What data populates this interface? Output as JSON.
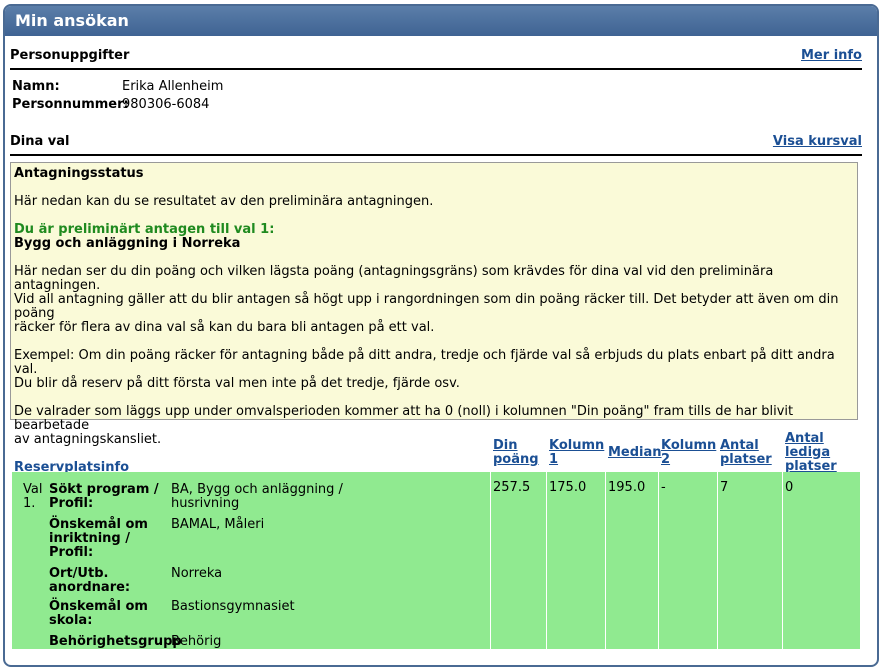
{
  "window": {
    "title": "Min ansökan"
  },
  "personal": {
    "heading": "Personuppgifter",
    "more_info_link": "Mer info",
    "name_label": "Namn:",
    "name_value": "Erika Allenheim",
    "pnr_label": "Personnummer:",
    "pnr_value": "980306-6084"
  },
  "choices": {
    "heading": "Dina val",
    "show_courses_link": "Visa kursval"
  },
  "status": {
    "title": "Antagningsstatus",
    "intro": "Här nedan kan du se resultatet av den preliminära antagningen.",
    "admitted_line": "Du är preliminärt antagen till val 1:",
    "admitted_program": "Bygg och anläggning i Norreka",
    "para1_l1": "Här nedan ser du din poäng och vilken lägsta poäng (antagningsgräns) som krävdes för dina val vid den preliminära antagningen.",
    "para1_l2": "Vid all antagning gäller att du blir antagen så högt upp i rangordningen som din poäng räcker till. Det betyder att även om din poäng",
    "para1_l3": "räcker för flera av dina val så kan du bara bli antagen på ett val.",
    "para2_l1": "Exempel: Om din poäng räcker för antagning både på ditt andra, tredje och fjärde val så erbjuds du plats enbart på ditt andra val.",
    "para2_l2": "Du blir då reserv på ditt första val men inte på det tredje, fjärde osv.",
    "para3_l1": "De valrader som läggs upp under omvalsperioden kommer att ha 0 (noll) i kolumnen \"Din poäng\" fram tills de har blivit bearbetade",
    "para3_l2": "av antagningskansliet.",
    "reserve_link": "Reservplatsinfo"
  },
  "columns": {
    "din_poang_1": "Din",
    "din_poang_2": "poäng",
    "kolumn1_1": "Kolumn",
    "kolumn1_2": "1",
    "median": "Median",
    "kolumn2_1": "Kolumn",
    "kolumn2_2": "2",
    "antal_platser_1": "Antal",
    "antal_platser_2": "platser",
    "lediga_1": "Antal",
    "lediga_2": "lediga",
    "lediga_3": "platser"
  },
  "row": {
    "val_1": "Val",
    "val_2": "1.",
    "program_label_1": "Sökt program /",
    "program_label_2": "Profil:",
    "program_value_1": "BA, Bygg och anläggning /",
    "program_value_2": "husrivning",
    "inr_label_1": "Önskemål om",
    "inr_label_2": "inriktning /",
    "inr_label_3": "Profil:",
    "inr_value": "BAMAL, Måleri",
    "ort_label_1": "Ort/Utb.",
    "ort_label_2": "anordnare:",
    "ort_value": "Norreka",
    "skola_label_1": "Önskemål om",
    "skola_label_2": "skola:",
    "skola_value": "Bastionsgymnasiet",
    "beh_label": "Behörighetsgrupp",
    "beh_value": "Behörig",
    "din_poang": "257.5",
    "kolumn1": "175.0",
    "median": "195.0",
    "kolumn2": "-",
    "antal_platser": "7",
    "lediga": "0"
  },
  "colors": {
    "header_bg": "#4a6f9e",
    "link": "#1b4f94",
    "status_bg": "#fafad8",
    "admitted_green": "#1f8a1f",
    "row_bg": "#90ea90"
  }
}
